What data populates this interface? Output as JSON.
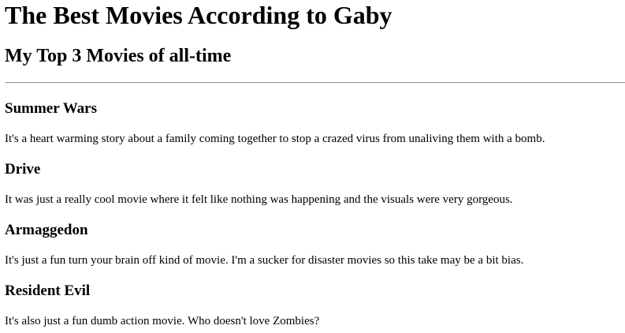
{
  "page": {
    "title": "The Best Movies According to Gaby",
    "subtitle": "My Top 3 Movies of all-time"
  },
  "movies": [
    {
      "title": "Summer Wars",
      "description": "It's a heart warming story about a family coming together to stop a crazed virus from unaliving them with a bomb."
    },
    {
      "title": "Drive",
      "description": "It was just a really cool movie where it felt like nothing was happening and the visuals were very gorgeous."
    },
    {
      "title": "Armaggedon",
      "description": "It's just a fun turn your brain off kind of movie. I'm a sucker for disaster movies so this take may be a bit bias."
    },
    {
      "title": "Resident Evil",
      "description": "It's also just a fun dumb action movie. Who doesn't love Zombies?"
    }
  ]
}
